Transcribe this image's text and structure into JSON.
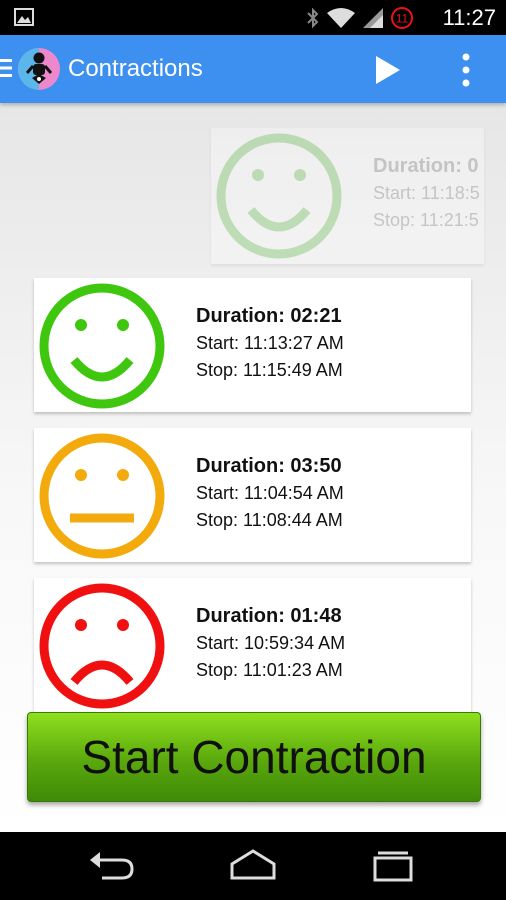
{
  "status_bar": {
    "time": "11:27",
    "icons": [
      "image-notification-icon",
      "bluetooth-icon",
      "wifi-icon",
      "signal-icon",
      "battery-alert-icon"
    ],
    "badge_text": "11"
  },
  "action_bar": {
    "title": "Contractions",
    "color": "#3d8ff0",
    "icons": [
      "drawer-icon",
      "baby-app-icon",
      "play-icon",
      "overflow-menu-icon"
    ]
  },
  "contractions": [
    {
      "mood": "happy",
      "color": "#c9e8c0",
      "duration": "Duration: 0",
      "start": "Start: 11:18:5",
      "stop": "Stop: 11:21:5",
      "faded": true
    },
    {
      "mood": "happy",
      "color": "#3ec70e",
      "duration": "Duration: 02:21",
      "start": "Start: 11:13:27 AM",
      "stop": "Stop: 11:15:49 AM",
      "faded": false
    },
    {
      "mood": "neutral",
      "color": "#f2aa0c",
      "duration": "Duration: 03:50",
      "start": "Start: 11:04:54 AM",
      "stop": "Stop: 11:08:44 AM",
      "faded": false
    },
    {
      "mood": "sad",
      "color": "#f01010",
      "duration": "Duration: 01:48",
      "start": "Start: 10:59:34 AM",
      "stop": "Stop: 11:01:23 AM",
      "faded": false
    }
  ],
  "start_button": {
    "label": "Start Contraction",
    "color": "#5aa80d"
  },
  "nav_bar": {
    "icons": [
      "back-icon",
      "home-icon",
      "recents-icon"
    ]
  }
}
